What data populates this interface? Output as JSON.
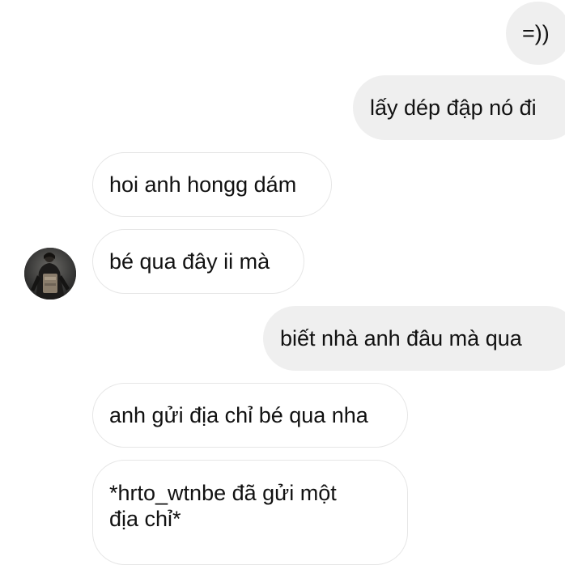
{
  "messages": [
    {
      "side": "sent",
      "text": "=))"
    },
    {
      "side": "sent",
      "text": "lấy dép đập nó đi"
    },
    {
      "side": "received",
      "text": "hoi anh hongg dám"
    },
    {
      "side": "received",
      "text": "bé qua đây ii mà"
    },
    {
      "side": "sent",
      "text": "biết nhà anh đâu mà qua"
    },
    {
      "side": "received",
      "text": "anh gửi địa chỉ bé qua nha"
    },
    {
      "side": "received",
      "text_line1": "*hrto_wtnbe đã gửi một",
      "text_line2": "địa chỉ*"
    }
  ],
  "colors": {
    "sent_bubble": "#efefef",
    "received_bubble": "#ffffff",
    "received_border": "#e6e6e6",
    "text": "#111111"
  },
  "avatar": {
    "icon": "user-avatar-photo"
  }
}
